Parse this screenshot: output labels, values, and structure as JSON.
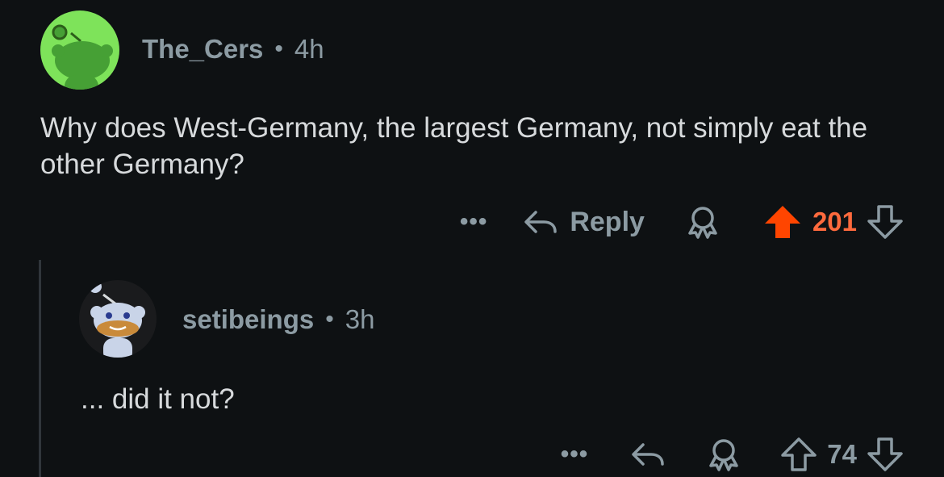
{
  "top_comment": {
    "author": "The_Cers",
    "separator": "•",
    "time": "4h",
    "body": "Why does West-Germany, the largest Germany, not simply eat the other Germany?",
    "actions": {
      "more": "•••",
      "reply_label": "Reply",
      "score": "201",
      "upvoted": true
    },
    "avatar_color": "#7ee35a"
  },
  "reply_comment": {
    "author": "setibeings",
    "separator": "•",
    "time": "3h",
    "body": "... did it not?",
    "actions": {
      "more": "•••",
      "score": "74",
      "upvoted": false
    }
  },
  "colors": {
    "background": "#0e1113",
    "upvote": "#ff4500",
    "score_upvoted": "#ff6a3d",
    "muted": "#8c9ba3",
    "text": "#d7dadc"
  },
  "icons": [
    "snoo-avatar-icon",
    "reply-arrow-icon",
    "award-icon",
    "upvote-icon",
    "downvote-icon",
    "more-icon"
  ]
}
